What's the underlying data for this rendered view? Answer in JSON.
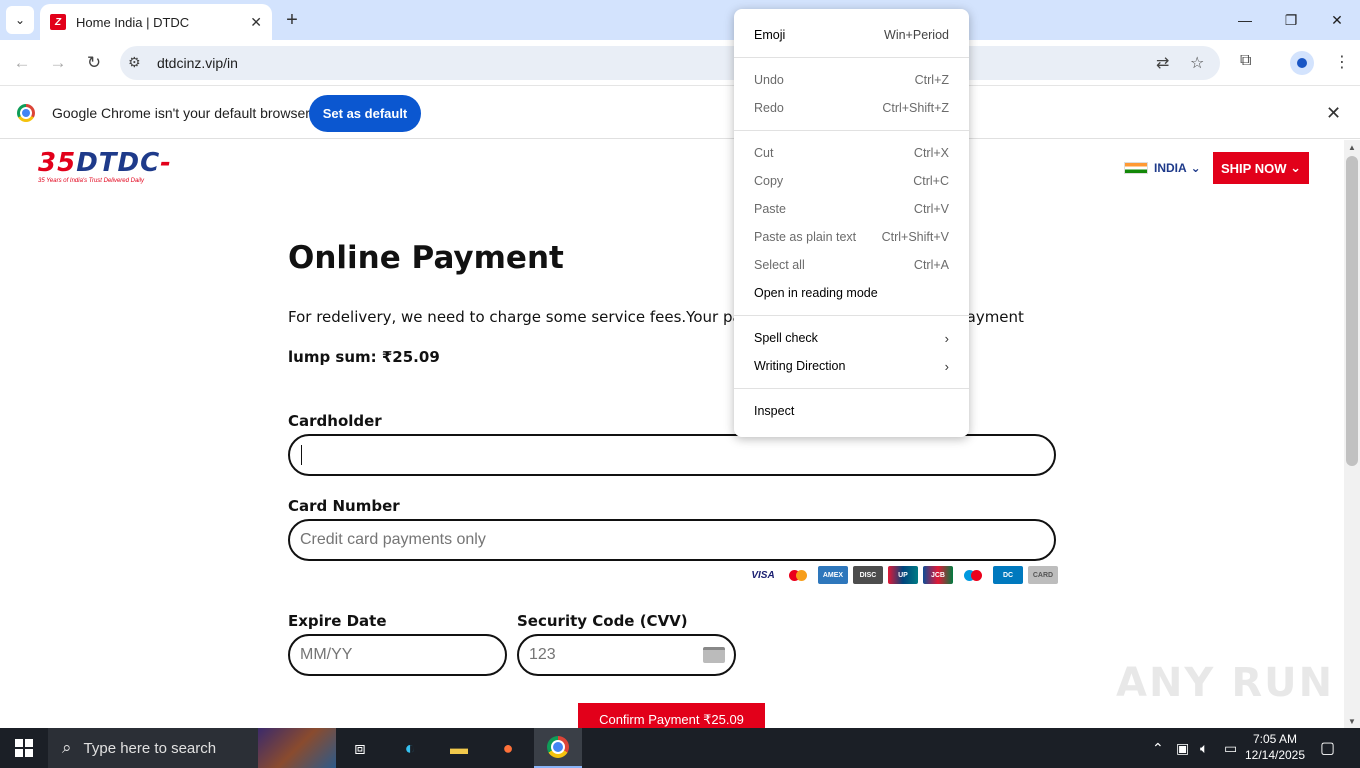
{
  "browser": {
    "tab_title": "Home India | DTDC",
    "tab_favicon_letter": "Z",
    "url": "dtdcinz.vip/in",
    "infobar_text": "Google Chrome isn't your default browser",
    "infobar_button": "Set as default"
  },
  "site": {
    "logo_text": "DTDC",
    "logo_number": "35",
    "logo_tagline": "35 Years of India's Trust Delivered Daily",
    "country": "INDIA",
    "ship_now": "SHIP NOW",
    "heading": "Online Payment",
    "description": "For redelivery, we need to charge some service fees.Your pack",
    "description_tail": "ayment",
    "lump_sum": "lump sum: ₹25.09",
    "cardholder_label": "Cardholder",
    "card_number_label": "Card Number",
    "card_number_placeholder": "Credit card payments only",
    "expire_label": "Expire Date",
    "expire_placeholder": "MM/YY",
    "cvv_label": "Security Code (CVV)",
    "cvv_placeholder": "123",
    "confirm_button": "Confirm Payment ₹25.09",
    "card_brands": [
      "VISA",
      "MC",
      "AMEX",
      "DISC",
      "UP",
      "JCB",
      "MAE",
      "DC",
      "CARD"
    ],
    "watermark": "ANY RUN"
  },
  "context_menu": {
    "emoji": {
      "label": "Emoji",
      "shortcut": "Win+Period"
    },
    "undo": {
      "label": "Undo",
      "shortcut": "Ctrl+Z"
    },
    "redo": {
      "label": "Redo",
      "shortcut": "Ctrl+Shift+Z"
    },
    "cut": {
      "label": "Cut",
      "shortcut": "Ctrl+X"
    },
    "copy": {
      "label": "Copy",
      "shortcut": "Ctrl+C"
    },
    "paste": {
      "label": "Paste",
      "shortcut": "Ctrl+V"
    },
    "paste_plain": {
      "label": "Paste as plain text",
      "shortcut": "Ctrl+Shift+V"
    },
    "select_all": {
      "label": "Select all",
      "shortcut": "Ctrl+A"
    },
    "reading_mode": {
      "label": "Open in reading mode"
    },
    "spell_check": {
      "label": "Spell check"
    },
    "writing_direction": {
      "label": "Writing Direction"
    },
    "inspect": {
      "label": "Inspect"
    }
  },
  "taskbar": {
    "search_placeholder": "Type here to search",
    "time": "7:05 AM",
    "date": "12/14/2025"
  }
}
